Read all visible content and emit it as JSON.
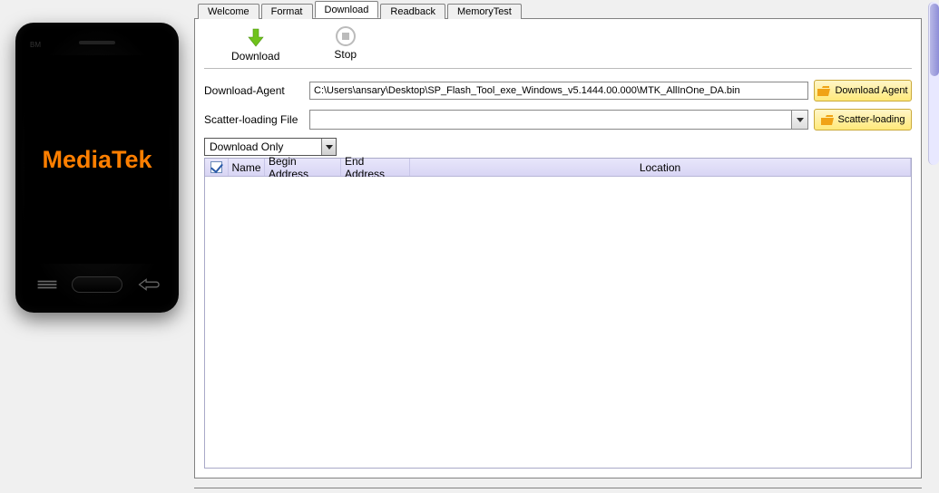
{
  "phone": {
    "bm": "BM",
    "logo": "MediaTek"
  },
  "tabs": [
    {
      "label": "Welcome",
      "active": false
    },
    {
      "label": "Format",
      "active": false
    },
    {
      "label": "Download",
      "active": true
    },
    {
      "label": "Readback",
      "active": false
    },
    {
      "label": "MemoryTest",
      "active": false
    }
  ],
  "toolbar": {
    "download": "Download",
    "stop": "Stop"
  },
  "form": {
    "download_agent_label": "Download-Agent",
    "download_agent_value": "C:\\Users\\ansary\\Desktop\\SP_Flash_Tool_exe_Windows_v5.1444.00.000\\MTK_AllInOne_DA.bin",
    "download_agent_btn": "Download Agent",
    "scatter_label": "Scatter-loading File",
    "scatter_value": "",
    "scatter_btn": "Scatter-loading",
    "mode": "Download Only"
  },
  "table": {
    "headers": {
      "name": "Name",
      "begin": "Begin Address",
      "end": "End Address",
      "location": "Location"
    },
    "rows": []
  }
}
